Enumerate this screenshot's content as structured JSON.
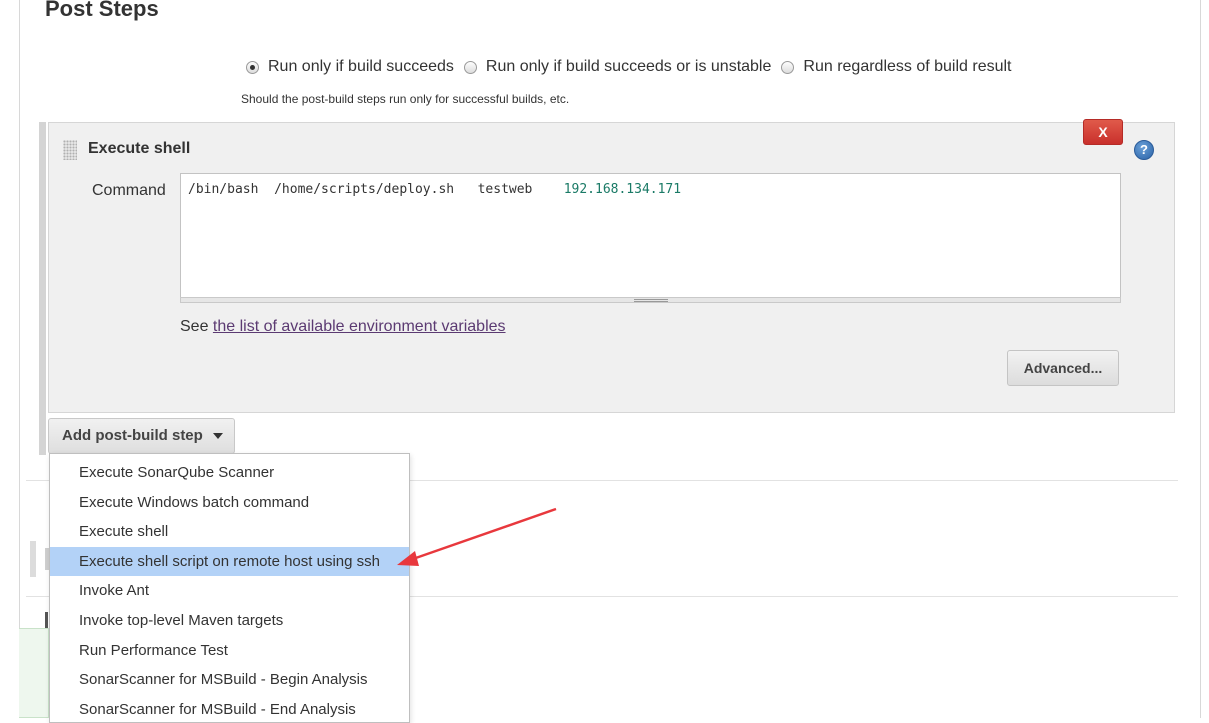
{
  "section": {
    "title": "Post Steps"
  },
  "run_condition": {
    "options": [
      {
        "label": "Run only if build succeeds",
        "checked": true
      },
      {
        "label": "Run only if build succeeds or is unstable",
        "checked": false
      },
      {
        "label": "Run regardless of build result",
        "checked": false
      }
    ],
    "help": "Should the post-build steps run only for successful builds, etc."
  },
  "step": {
    "title": "Execute shell",
    "delete_label": "X",
    "help_icon": "?",
    "command_label": "Command",
    "command_text": "/bin/bash  /home/scripts/deploy.sh   testweb    ",
    "command_ip": "192.168.134.171",
    "see_prefix": "See ",
    "env_link": "the list of available environment variables",
    "advanced_label": "Advanced..."
  },
  "add_step": {
    "label": "Add post-build step"
  },
  "dropdown": {
    "items": [
      "Execute SonarQube Scanner",
      "Execute Windows batch command",
      "Execute shell",
      "Execute shell script on remote host using ssh",
      "Invoke Ant",
      "Invoke top-level Maven targets",
      "Run Performance Test",
      "SonarScanner for MSBuild - Begin Analysis",
      "SonarScanner for MSBuild - End Analysis"
    ],
    "highlighted_index": 3
  },
  "colors": {
    "annotation_arrow": "#e8383d",
    "highlight": "#b3d2f7",
    "delete_button": "#c9302c",
    "link": "#5b3a72"
  }
}
